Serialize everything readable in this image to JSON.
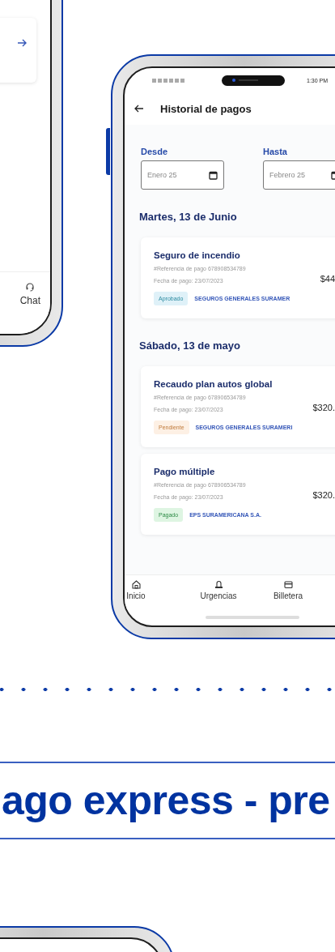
{
  "side_phone": {
    "nav_items": [
      {
        "label": "Chat"
      }
    ]
  },
  "payment_history": {
    "status_time": "1:30 PM",
    "title": "Historial de pagos",
    "filters": [
      {
        "label": "Desde",
        "value": "Enero 25"
      },
      {
        "label": "Hasta",
        "value": "Febrero 25"
      }
    ],
    "groups": [
      {
        "date": "Martes, 13 de Junio",
        "payments": [
          {
            "title": "Seguro de incendio",
            "reference": "#Referencia de pago 678908534789",
            "date": "Fecha de pago: 23/07/2023",
            "amount": "$44",
            "status": {
              "label": "Aprobado",
              "kind": "approved"
            },
            "company": "SEGUROS GENERALES SURAMER"
          }
        ]
      },
      {
        "date": "Sábado, 13 de mayo",
        "payments": [
          {
            "title": "Recaudo plan autos global",
            "reference": "#Referencia de pago 678906534789",
            "date": "Fecha de pago: 23/07/2023",
            "amount": "$320.",
            "status": {
              "label": "Pendiente",
              "kind": "pending"
            },
            "company": "SEGUROS GENERALES SURAMERI"
          },
          {
            "title": "Pago múltiple",
            "reference": "#Referencia de pago 678906534789",
            "date": "Fecha de pago: 23/07/2023",
            "amount": "$320.",
            "status": {
              "label": "Pagado",
              "kind": "paid"
            },
            "company": "EPS SURAMERICANA S.A."
          }
        ]
      }
    ],
    "nav_items": [
      {
        "label": "Inicio"
      },
      {
        "label": "Urgencias"
      },
      {
        "label": "Billetera"
      }
    ]
  },
  "section_title": "ago express - pre"
}
